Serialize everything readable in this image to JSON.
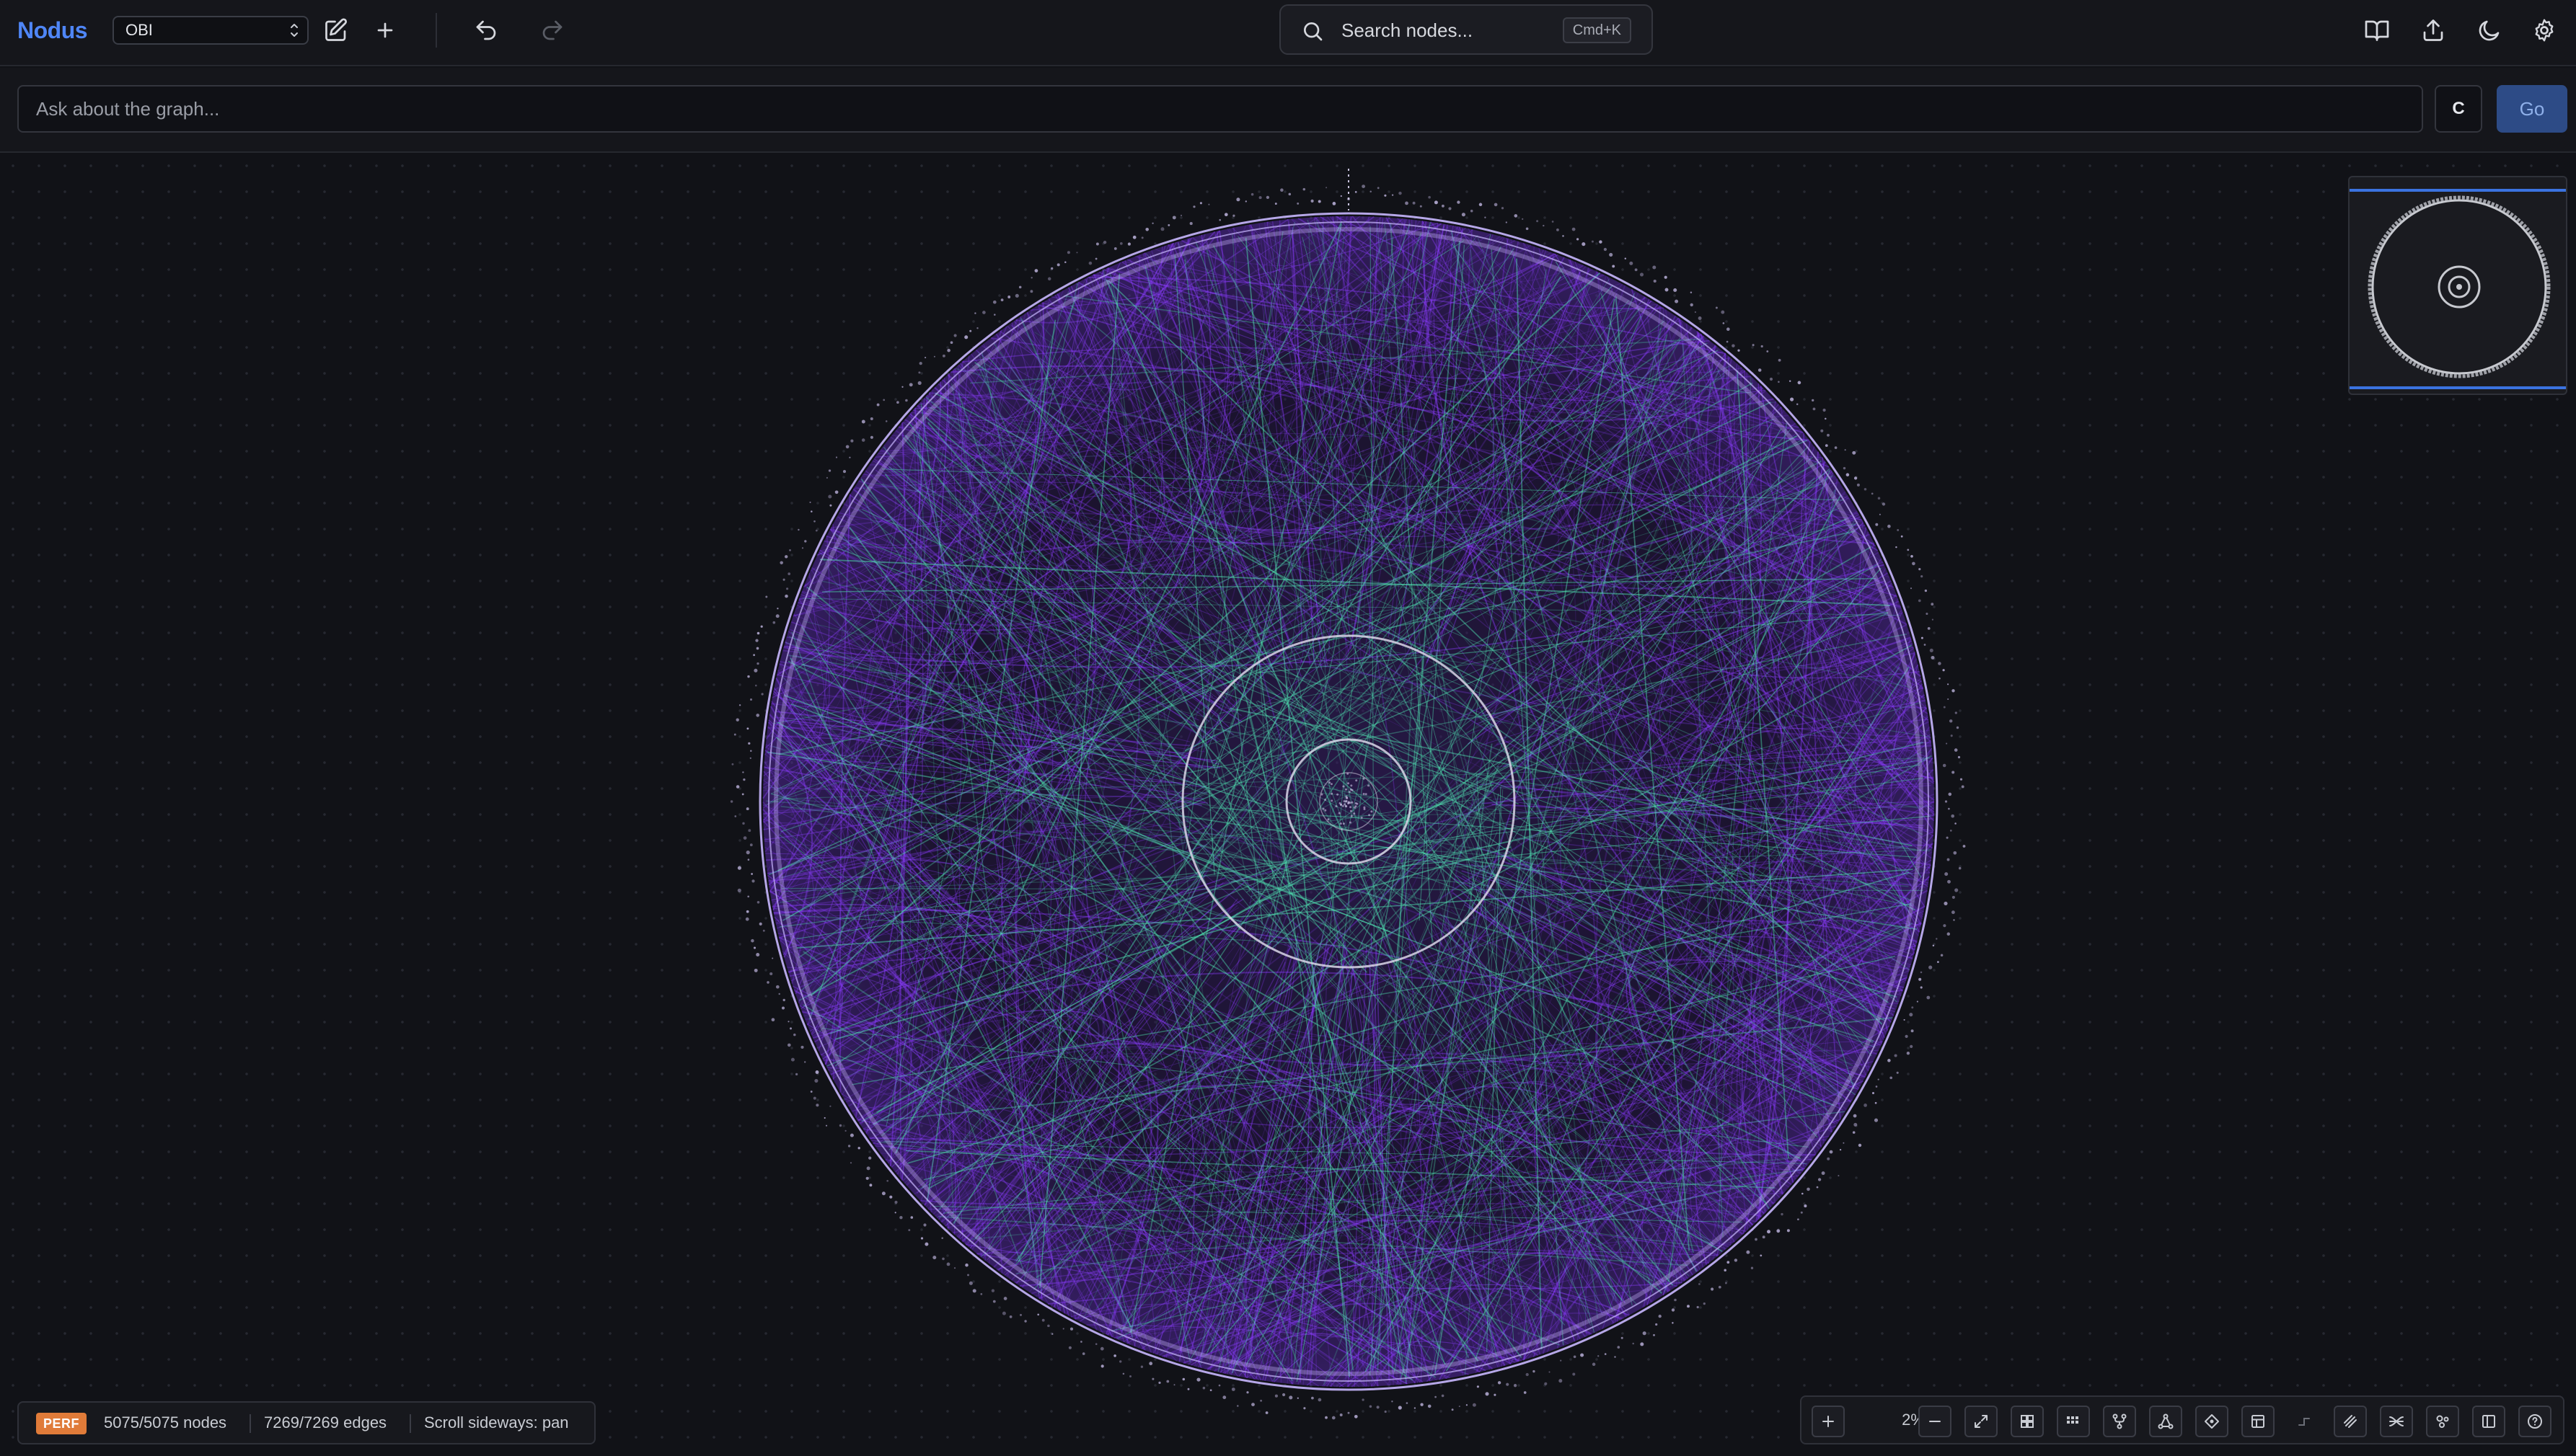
{
  "app": {
    "brand": "Nodus",
    "selected_graph": "OBI"
  },
  "search": {
    "label": "Search nodes...",
    "shortcut": "Cmd+K"
  },
  "ask": {
    "placeholder": "Ask about the graph...",
    "c_label": "C",
    "go_label": "Go"
  },
  "status": {
    "badge": "PERF",
    "nodes": "5075/5075 nodes",
    "edges": "7269/7269 edges",
    "hint": "Scroll sideways: pan"
  },
  "zoom": {
    "level": "2%"
  },
  "colors": {
    "brand": "#4f86f7",
    "edge_purple": "#8b3dff",
    "edge_teal": "#4fe0b0",
    "ring": "#c9b8ff",
    "perf_badge": "#e07b39",
    "go_button": "#2d4b86"
  },
  "icons": {
    "top_left": [
      "edit-icon",
      "plus-icon",
      "undo-icon",
      "redo-icon"
    ],
    "top_right": [
      "book-icon",
      "export-icon",
      "moon-icon",
      "gear-icon"
    ],
    "toolbar": [
      "zoom-in-icon",
      "zoom-out-icon",
      "fit-view-icon",
      "grid-layout-icon",
      "compact-grid-icon",
      "tree-layout-icon",
      "hierarchy-layout-icon",
      "radial-layout-icon",
      "table-icon",
      "edge-route-icon",
      "hatch-icon",
      "bundle-icon",
      "cluster-icon",
      "sidebar-icon",
      "help-icon"
    ]
  }
}
